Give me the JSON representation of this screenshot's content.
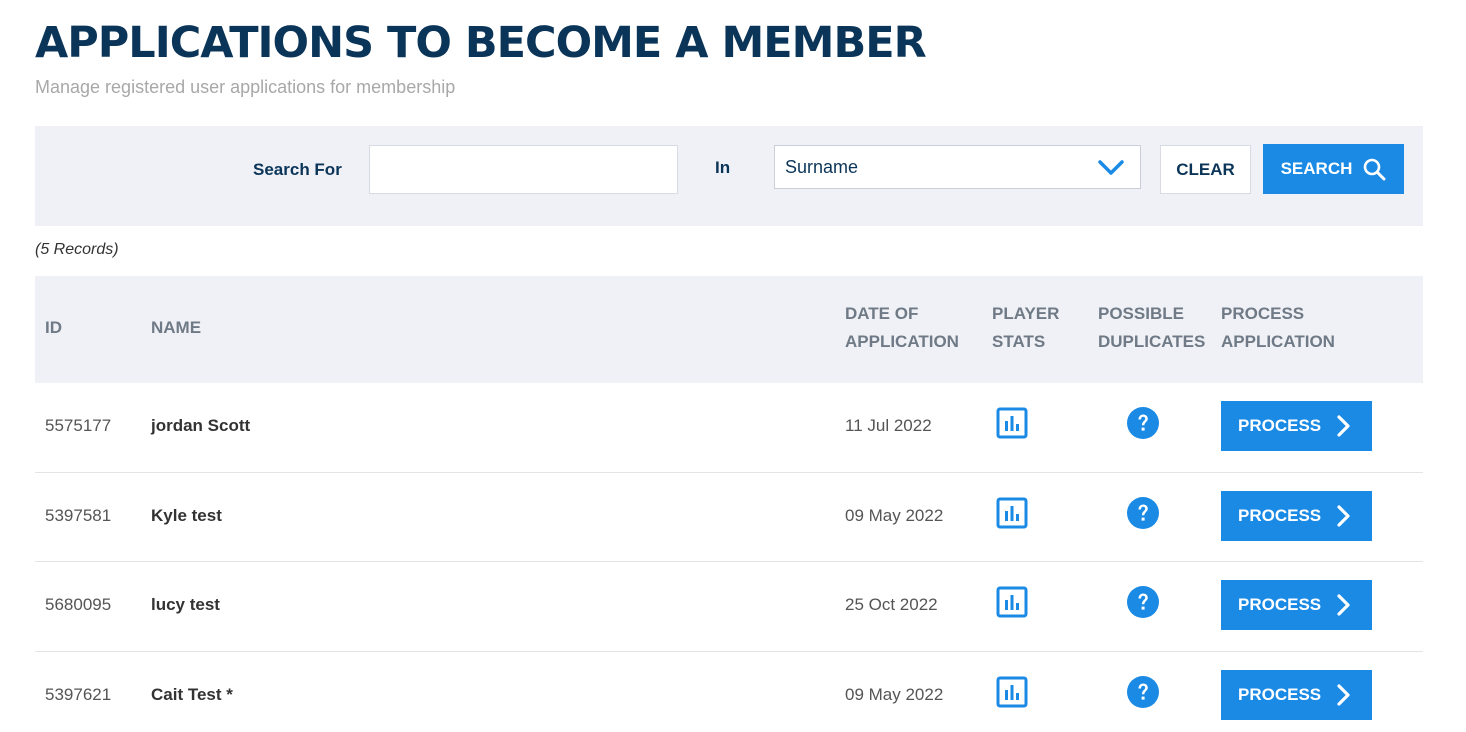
{
  "header": {
    "title": "APPLICATIONS TO BECOME A MEMBER",
    "subtitle": "Manage registered user applications for membership"
  },
  "search": {
    "search_for_label": "Search For",
    "input_value": "",
    "in_label": "In",
    "field_selected": "Surname",
    "clear_label": "CLEAR",
    "search_label": "SEARCH"
  },
  "records_count": "(5 Records)",
  "table": {
    "headers": {
      "id": "ID",
      "name": "NAME",
      "date": "DATE OF\nAPPLICATION",
      "stats": "PLAYER\nSTATS",
      "duplicates": "POSSIBLE\nDUPLICATES",
      "process": "PROCESS\nAPPLICATION"
    },
    "rows": [
      {
        "id": "5575177",
        "name": "jordan Scott",
        "date": "11 Jul 2022",
        "action": "PROCESS"
      },
      {
        "id": "5397581",
        "name": "Kyle test",
        "date": "09 May 2022",
        "action": "PROCESS"
      },
      {
        "id": "5680095",
        "name": "lucy test",
        "date": "25 Oct 2022",
        "action": "PROCESS"
      },
      {
        "id": "5397621",
        "name": "Cait Test *",
        "date": "09 May 2022",
        "action": "PROCESS"
      }
    ]
  },
  "icons": {
    "stats": "bar-chart-icon",
    "duplicates": "question-circle-icon",
    "search": "magnifier-icon",
    "process": "chevron-right-icon",
    "select": "chevron-down-icon"
  },
  "colors": {
    "primary": "#1a8ae5",
    "title": "#0b3558",
    "panel_bg": "#eff1f6"
  }
}
